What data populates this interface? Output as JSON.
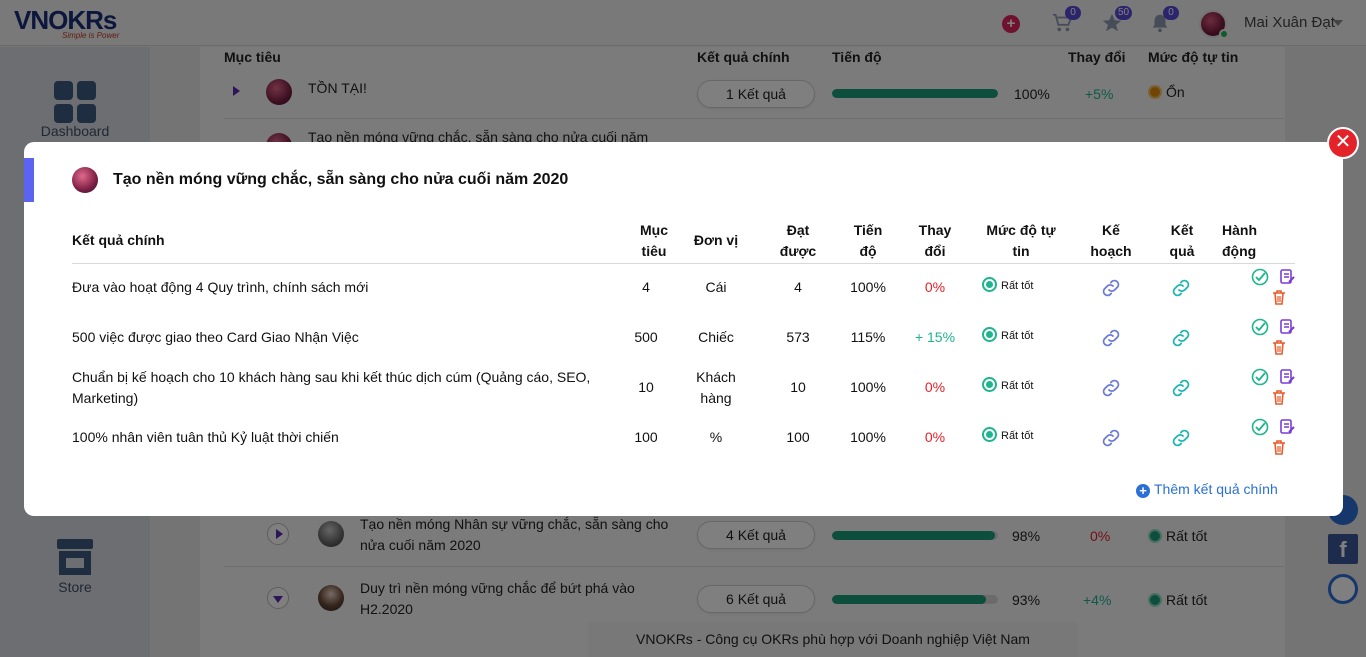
{
  "app": {
    "logo_text": "VNOKRs",
    "logo_tagline": "Simple is Power",
    "user_name": "Mai Xuân Đạt",
    "badges": {
      "cart": "0",
      "star": "50",
      "bell": "0"
    }
  },
  "sidebar": {
    "dashboard": "Dashboard",
    "store": "Store"
  },
  "background_table": {
    "headers": {
      "objective": "Mục tiêu",
      "key_results": "Kết quả chính",
      "progress": "Tiến độ",
      "change": "Thay đổi",
      "confidence": "Mức độ tự tin"
    },
    "rows": [
      {
        "title": "TỒN TẠI!",
        "kr": "1 Kết quả",
        "progress_label": "100%",
        "progress_fraction": 1.0,
        "change": "+5%",
        "confidence": "Ổn"
      },
      {
        "title": "Tạo nền móng vững chắc, sẵn sàng cho nửa cuối năm"
      },
      {
        "title": "Tạo nền móng Nhân sự vững chắc, sẵn sàng cho nửa cuối năm 2020",
        "kr": "4 Kết quả",
        "progress_label": "98%",
        "progress_fraction": 0.98,
        "change": "0%",
        "confidence": "Rất tốt"
      },
      {
        "title": "Duy trì nền móng vững chắc để bứt phá vào H2.2020",
        "kr": "6 Kết quả",
        "progress_label": "93%",
        "progress_fraction": 0.93,
        "change": "+4%",
        "confidence": "Rất tốt"
      }
    ]
  },
  "footer": "VNOKRs - Công cụ OKRs phù hợp với Doanh nghiệp Việt Nam",
  "modal": {
    "title": "Tạo nền móng vững chắc, sẵn sàng cho nửa cuối năm 2020",
    "headers": {
      "kr": "Kết quả chính",
      "target_1": "Mục",
      "target_2": "tiêu",
      "unit": "Đơn vị",
      "achieved_1": "Đạt",
      "achieved_2": "được",
      "progress_1": "Tiến",
      "progress_2": "độ",
      "change_1": "Thay",
      "change_2": "đổi",
      "conf_1": "Mức độ tự",
      "conf_2": "tin",
      "plan_1": "Kế",
      "plan_2": "hoạch",
      "result_1": "Kết",
      "result_2": "quả",
      "action_1": "Hành",
      "action_2": "động"
    },
    "rows": [
      {
        "kr_1": "Đưa vào hoạt động 4 Quy trình, chính sách mới",
        "kr_2": "",
        "target": "4",
        "unit_1": "Cái",
        "unit_2": "",
        "achieved": "4",
        "progress": "100%",
        "change": "0%",
        "confidence": "Rất tốt"
      },
      {
        "kr_1": "500 việc được giao theo Card Giao Nhận Việc",
        "kr_2": "",
        "target": "500",
        "unit_1": "Chiếc",
        "unit_2": "",
        "achieved": "573",
        "progress": "115%",
        "change": "+ 15%",
        "confidence": "Rất tốt"
      },
      {
        "kr_1": "Chuẩn bị kế hoạch cho 10 khách hàng sau khi kết thúc dịch cúm (Quảng cáo, SEO,",
        "kr_2": "Marketing)",
        "target": "10",
        "unit_1": "Khách",
        "unit_2": "hàng",
        "achieved": "10",
        "progress": "100%",
        "change": "0%",
        "confidence": "Rất tốt"
      },
      {
        "kr_1": "100% nhân viên tuân thủ Kỷ luật thời chiến",
        "kr_2": "",
        "target": "100",
        "unit_1": "%",
        "unit_2": "",
        "achieved": "100",
        "progress": "100%",
        "change": "0%",
        "confidence": "Rất tốt"
      }
    ],
    "add_button": "Thêm kết quả chính"
  },
  "colors": {
    "accent": "#5b63f0",
    "progress": "#1a9c7a",
    "positive": "#1db58c",
    "negative": "#e3222a",
    "link": "#2a6fd6"
  }
}
